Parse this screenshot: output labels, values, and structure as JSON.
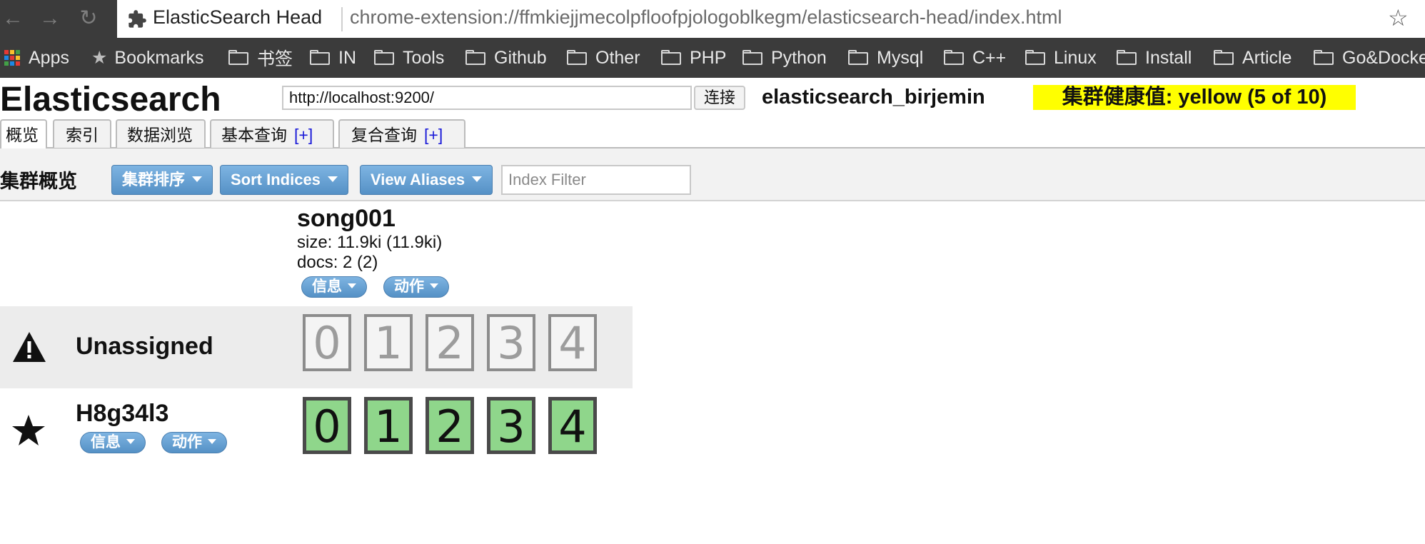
{
  "browser": {
    "tab_title": "ElasticSearch Head",
    "url": "chrome-extension://ffmkiejjmecolpfloofpjologoblkegm/elasticsearch-head/index.html",
    "bookmarks": [
      "Apps",
      "Bookmarks",
      "书签",
      "IN",
      "Tools",
      "Github",
      "Other",
      "PHP",
      "Python",
      "Mysql",
      "C++",
      "Linux",
      "Install",
      "Article",
      "Go&Docke"
    ]
  },
  "app": {
    "title": "Elasticsearch",
    "connect_url": "http://localhost:9200/",
    "connect_button": "连接",
    "cluster_name": "elasticsearch_birjemin",
    "health": "集群健康值: yellow (5 of 10)",
    "health_color": "#ffff00"
  },
  "tabs": [
    {
      "label": "概览",
      "active": true
    },
    {
      "label": "索引"
    },
    {
      "label": "数据浏览"
    },
    {
      "label": "基本查询",
      "plus": "[+]"
    },
    {
      "label": "复合查询",
      "plus": "[+]"
    }
  ],
  "overview": {
    "title": "集群概览",
    "sort_cluster": "集群排序",
    "sort_indices": "Sort Indices",
    "view_aliases": "View Aliases",
    "index_filter_placeholder": "Index Filter"
  },
  "index": {
    "name": "song001",
    "size": "size: 11.9ki (11.9ki)",
    "docs": "docs: 2 (2)",
    "info_button": "信息",
    "action_button": "动作"
  },
  "rows": {
    "unassigned": {
      "label": "Unassigned",
      "icon": "warning-icon",
      "shards": [
        "0",
        "1",
        "2",
        "3",
        "4"
      ]
    },
    "node": {
      "name": "H8g34l3",
      "icon": "star-icon",
      "info_button": "信息",
      "action_button": "动作",
      "shards": [
        "0",
        "1",
        "2",
        "3",
        "4"
      ],
      "shard_color": "#8fd68b"
    }
  }
}
